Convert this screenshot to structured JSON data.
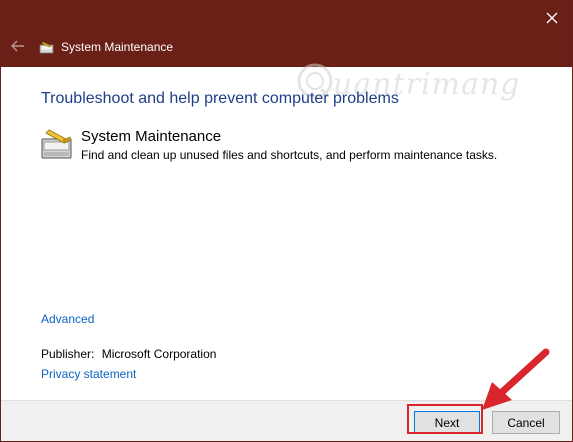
{
  "window": {
    "title": "System Maintenance",
    "title_icon": "system-maintenance-icon",
    "close_icon": "close-icon",
    "back_icon": "back-arrow-icon",
    "titlebar_color": "#6a1f17"
  },
  "main": {
    "heading": "Troubleshoot and help prevent computer problems",
    "item": {
      "title": "System Maintenance",
      "description": "Find and clean up unused files and shortcuts, and perform maintenance tasks.",
      "icon": "system-maintenance-icon"
    },
    "advanced_link": "Advanced",
    "publisher_label": "Publisher:",
    "publisher_value": "Microsoft Corporation",
    "privacy_link": "Privacy statement"
  },
  "watermark": {
    "text": "uantrimang",
    "icon": "quantrimang-logo-icon"
  },
  "footer": {
    "next_label": "Next",
    "cancel_label": "Cancel"
  },
  "annotation": {
    "arrow_color": "#d8262c",
    "highlight_color": "#d8262c"
  }
}
